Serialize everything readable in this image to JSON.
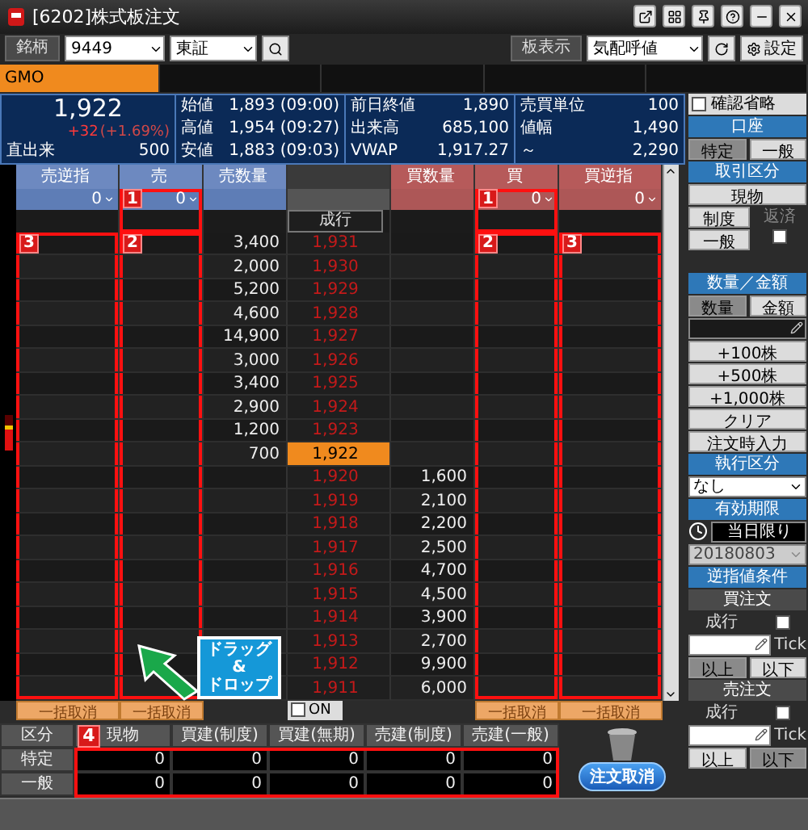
{
  "window": {
    "title": "[6202]株式板注文"
  },
  "toolbar": {
    "symbol_label": "銘柄",
    "symbol": "9449",
    "market": "東証",
    "board_label": "板表示",
    "board_mode": "気配呼値",
    "settings": "設定"
  },
  "tabs": [
    {
      "label": "GMO",
      "selected": true
    }
  ],
  "quote": {
    "price": "1,922",
    "change": "+32",
    "change_pct": "(+1.69%)",
    "last_volume_label": "直出来",
    "last_volume": "500",
    "stats": [
      [
        {
          "label": "始値",
          "value": "1,893 (09:00)"
        },
        {
          "label": "高値",
          "value": "1,954 (09:27)"
        },
        {
          "label": "安値",
          "value": "1,883 (09:03)"
        }
      ],
      [
        {
          "label": "前日終値",
          "value": "1,890"
        },
        {
          "label": "出来高",
          "value": "685,100"
        },
        {
          "label": "VWAP",
          "value": "1,917.27"
        }
      ],
      [
        {
          "label": "売買単位",
          "value": "100"
        },
        {
          "label": "値幅",
          "value": "1,490"
        },
        {
          "label": "～",
          "value": "2,290"
        }
      ]
    ]
  },
  "board": {
    "columns": [
      {
        "label": "売逆指",
        "kind": "sell",
        "input": "0",
        "body_marker": "3"
      },
      {
        "label": "売",
        "kind": "sell",
        "input": "0",
        "order_marker": "1",
        "body_marker": "2"
      },
      {
        "label": "売数量",
        "kind": "sell"
      },
      {
        "kind": "price"
      },
      {
        "label": "買数量",
        "kind": "buy"
      },
      {
        "label": "買",
        "kind": "buy",
        "input": "0",
        "order_marker": "1",
        "body_marker": "2"
      },
      {
        "label": "買逆指",
        "kind": "buy",
        "input": "0",
        "body_marker": "3"
      }
    ],
    "market_label": "成行",
    "rows": [
      {
        "sell_qty": "3,400",
        "price": "1,931",
        "current": false
      },
      {
        "sell_qty": "2,000",
        "price": "1,930",
        "current": false
      },
      {
        "sell_qty": "5,200",
        "price": "1,929",
        "current": false
      },
      {
        "sell_qty": "4,600",
        "price": "1,928",
        "current": false
      },
      {
        "sell_qty": "14,900",
        "price": "1,927",
        "current": false
      },
      {
        "sell_qty": "3,000",
        "price": "1,926",
        "current": false
      },
      {
        "sell_qty": "3,400",
        "price": "1,925",
        "current": false
      },
      {
        "sell_qty": "2,900",
        "price": "1,924",
        "current": false
      },
      {
        "sell_qty": "1,200",
        "price": "1,923",
        "current": false
      },
      {
        "sell_qty": "700",
        "price": "1,922",
        "current": true
      },
      {
        "price": "1,920",
        "buy_qty": "1,600",
        "current": false
      },
      {
        "price": "1,919",
        "buy_qty": "2,100",
        "current": false
      },
      {
        "price": "1,918",
        "buy_qty": "2,200",
        "current": false
      },
      {
        "price": "1,917",
        "buy_qty": "2,500",
        "current": false
      },
      {
        "price": "1,916",
        "buy_qty": "4,700",
        "current": false
      },
      {
        "price": "1,915",
        "buy_qty": "4,500",
        "current": false
      },
      {
        "price": "1,914",
        "buy_qty": "3,900",
        "current": false
      },
      {
        "price": "1,913",
        "buy_qty": "2,700",
        "current": false
      },
      {
        "price": "1,912",
        "buy_qty": "9,900",
        "current": false
      },
      {
        "price": "1,911",
        "buy_qty": "6,000",
        "current": false
      }
    ],
    "callout": [
      "ドラッグ",
      "&",
      "ドロップ"
    ]
  },
  "bulk_cancel": {
    "buttons": [
      {
        "label": "一括取消",
        "disabled": true
      },
      {
        "label": "一括取消",
        "disabled": true
      },
      {
        "label": "一括取消",
        "disabled": true
      },
      {
        "label": "一括取消",
        "disabled": true
      }
    ],
    "on_checkbox": {
      "label": "ON",
      "checked": false
    }
  },
  "positions": {
    "columns": [
      "区分",
      "現物",
      "買建(制度)",
      "買建(無期)",
      "売建(制度)",
      "売建(一般)"
    ],
    "rows": [
      {
        "label": "特定",
        "values": [
          "0",
          "0",
          "0",
          "0",
          "0"
        ]
      },
      {
        "label": "一般",
        "values": [
          "0",
          "0",
          "0",
          "0",
          "0"
        ]
      }
    ],
    "annotation": {
      "label": "4"
    },
    "cancel_button": "注文取消"
  },
  "side_panel": [
    {
      "kind": "checkbox",
      "label": "確認省略",
      "checked": false
    },
    {
      "kind": "header",
      "label": "口座"
    },
    {
      "kind": "segmented",
      "options": [
        {
          "label": "特定",
          "selected": true
        },
        {
          "label": "一般",
          "selected": false
        }
      ]
    },
    {
      "kind": "header",
      "label": "取引区分"
    },
    {
      "kind": "button",
      "label": "現物"
    },
    {
      "kind": "button_label",
      "button": "制度",
      "label": "返済",
      "label_disabled": true
    },
    {
      "kind": "button_check",
      "button": "一般",
      "checked": false
    },
    {
      "kind": "spacer"
    },
    {
      "kind": "header",
      "label": "数量／金額"
    },
    {
      "kind": "segmented",
      "options": [
        {
          "label": "数量",
          "selected": true
        },
        {
          "label": "金額",
          "selected": false
        }
      ]
    },
    {
      "kind": "input"
    },
    {
      "kind": "button",
      "label": "+100株"
    },
    {
      "kind": "button",
      "label": "+500株"
    },
    {
      "kind": "button",
      "label": "+1,000株"
    },
    {
      "kind": "button",
      "label": "クリア"
    },
    {
      "kind": "button",
      "label": "注文時入力"
    },
    {
      "kind": "header",
      "label": "執行区分"
    },
    {
      "kind": "select",
      "value": "なし"
    },
    {
      "kind": "header",
      "label": "有効期限"
    },
    {
      "kind": "expiry",
      "label": "当日限り"
    },
    {
      "kind": "date",
      "value": "20180803",
      "disabled": true
    },
    {
      "kind": "header",
      "label": "逆指値条件"
    },
    {
      "kind": "subheader",
      "label": "買注文"
    },
    {
      "kind": "label_check",
      "label": "成行",
      "checked": false
    },
    {
      "kind": "input_unit",
      "unit": "Tick"
    },
    {
      "kind": "segmented",
      "options": [
        {
          "label": "以上",
          "selected": true
        },
        {
          "label": "以下",
          "selected": false
        }
      ]
    },
    {
      "kind": "subheader",
      "label": "売注文"
    },
    {
      "kind": "label_check",
      "label": "成行",
      "checked": false
    },
    {
      "kind": "input_unit",
      "unit": "Tick"
    },
    {
      "kind": "segmented",
      "options": [
        {
          "label": "以上",
          "selected": false
        },
        {
          "label": "以下",
          "selected": true
        }
      ]
    }
  ]
}
